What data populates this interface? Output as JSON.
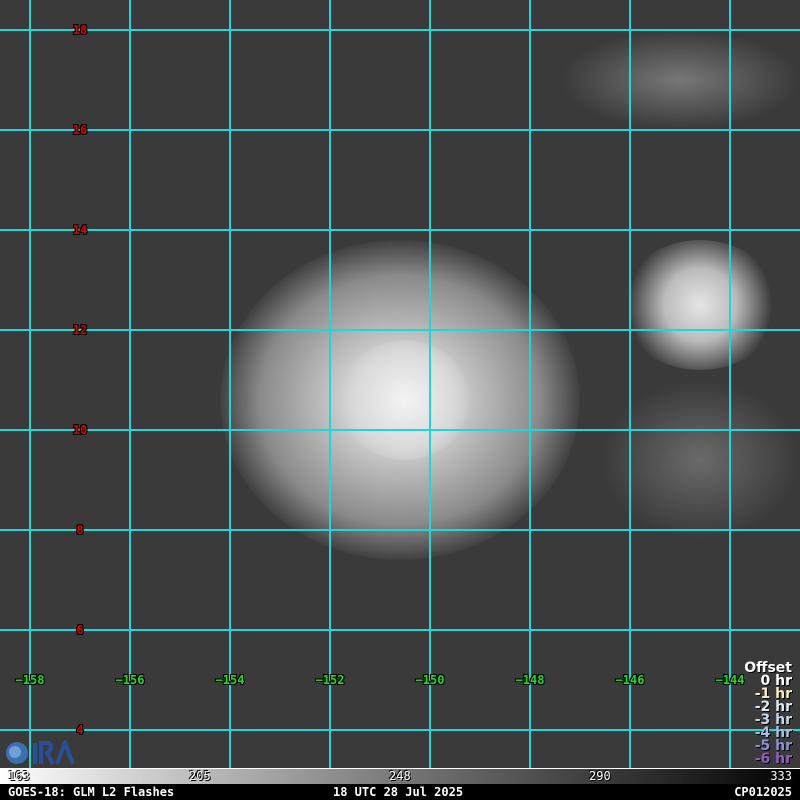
{
  "map": {
    "lat_labels": [
      "18",
      "16",
      "14",
      "12",
      "10",
      "8",
      "6",
      "4"
    ],
    "lon_labels": [
      "−158",
      "−156",
      "−154",
      "−152",
      "−150",
      "−148",
      "−146",
      "−144"
    ],
    "grid_color": "#1ad9d9",
    "logo": "CIRA"
  },
  "offset_legend": {
    "title": "Offset",
    "items": [
      {
        "label": "0 hr",
        "color": "#ffffff"
      },
      {
        "label": "-1 hr",
        "color": "#f5f0c0"
      },
      {
        "label": "-2 hr",
        "color": "#e0e8f0"
      },
      {
        "label": "-3 hr",
        "color": "#c8d8e8"
      },
      {
        "label": "-4 hr",
        "color": "#a8c0e0"
      },
      {
        "label": "-5 hr",
        "color": "#9090d0"
      },
      {
        "label": "-6 hr",
        "color": "#9060c0"
      }
    ]
  },
  "colorbar": {
    "ticks": [
      "163",
      "205",
      "248",
      "290",
      "333"
    ]
  },
  "footer": {
    "left": "GOES-18: GLM L2 Flashes",
    "center": "18 UTC 28 Jul 2025",
    "right": "CP012025"
  }
}
